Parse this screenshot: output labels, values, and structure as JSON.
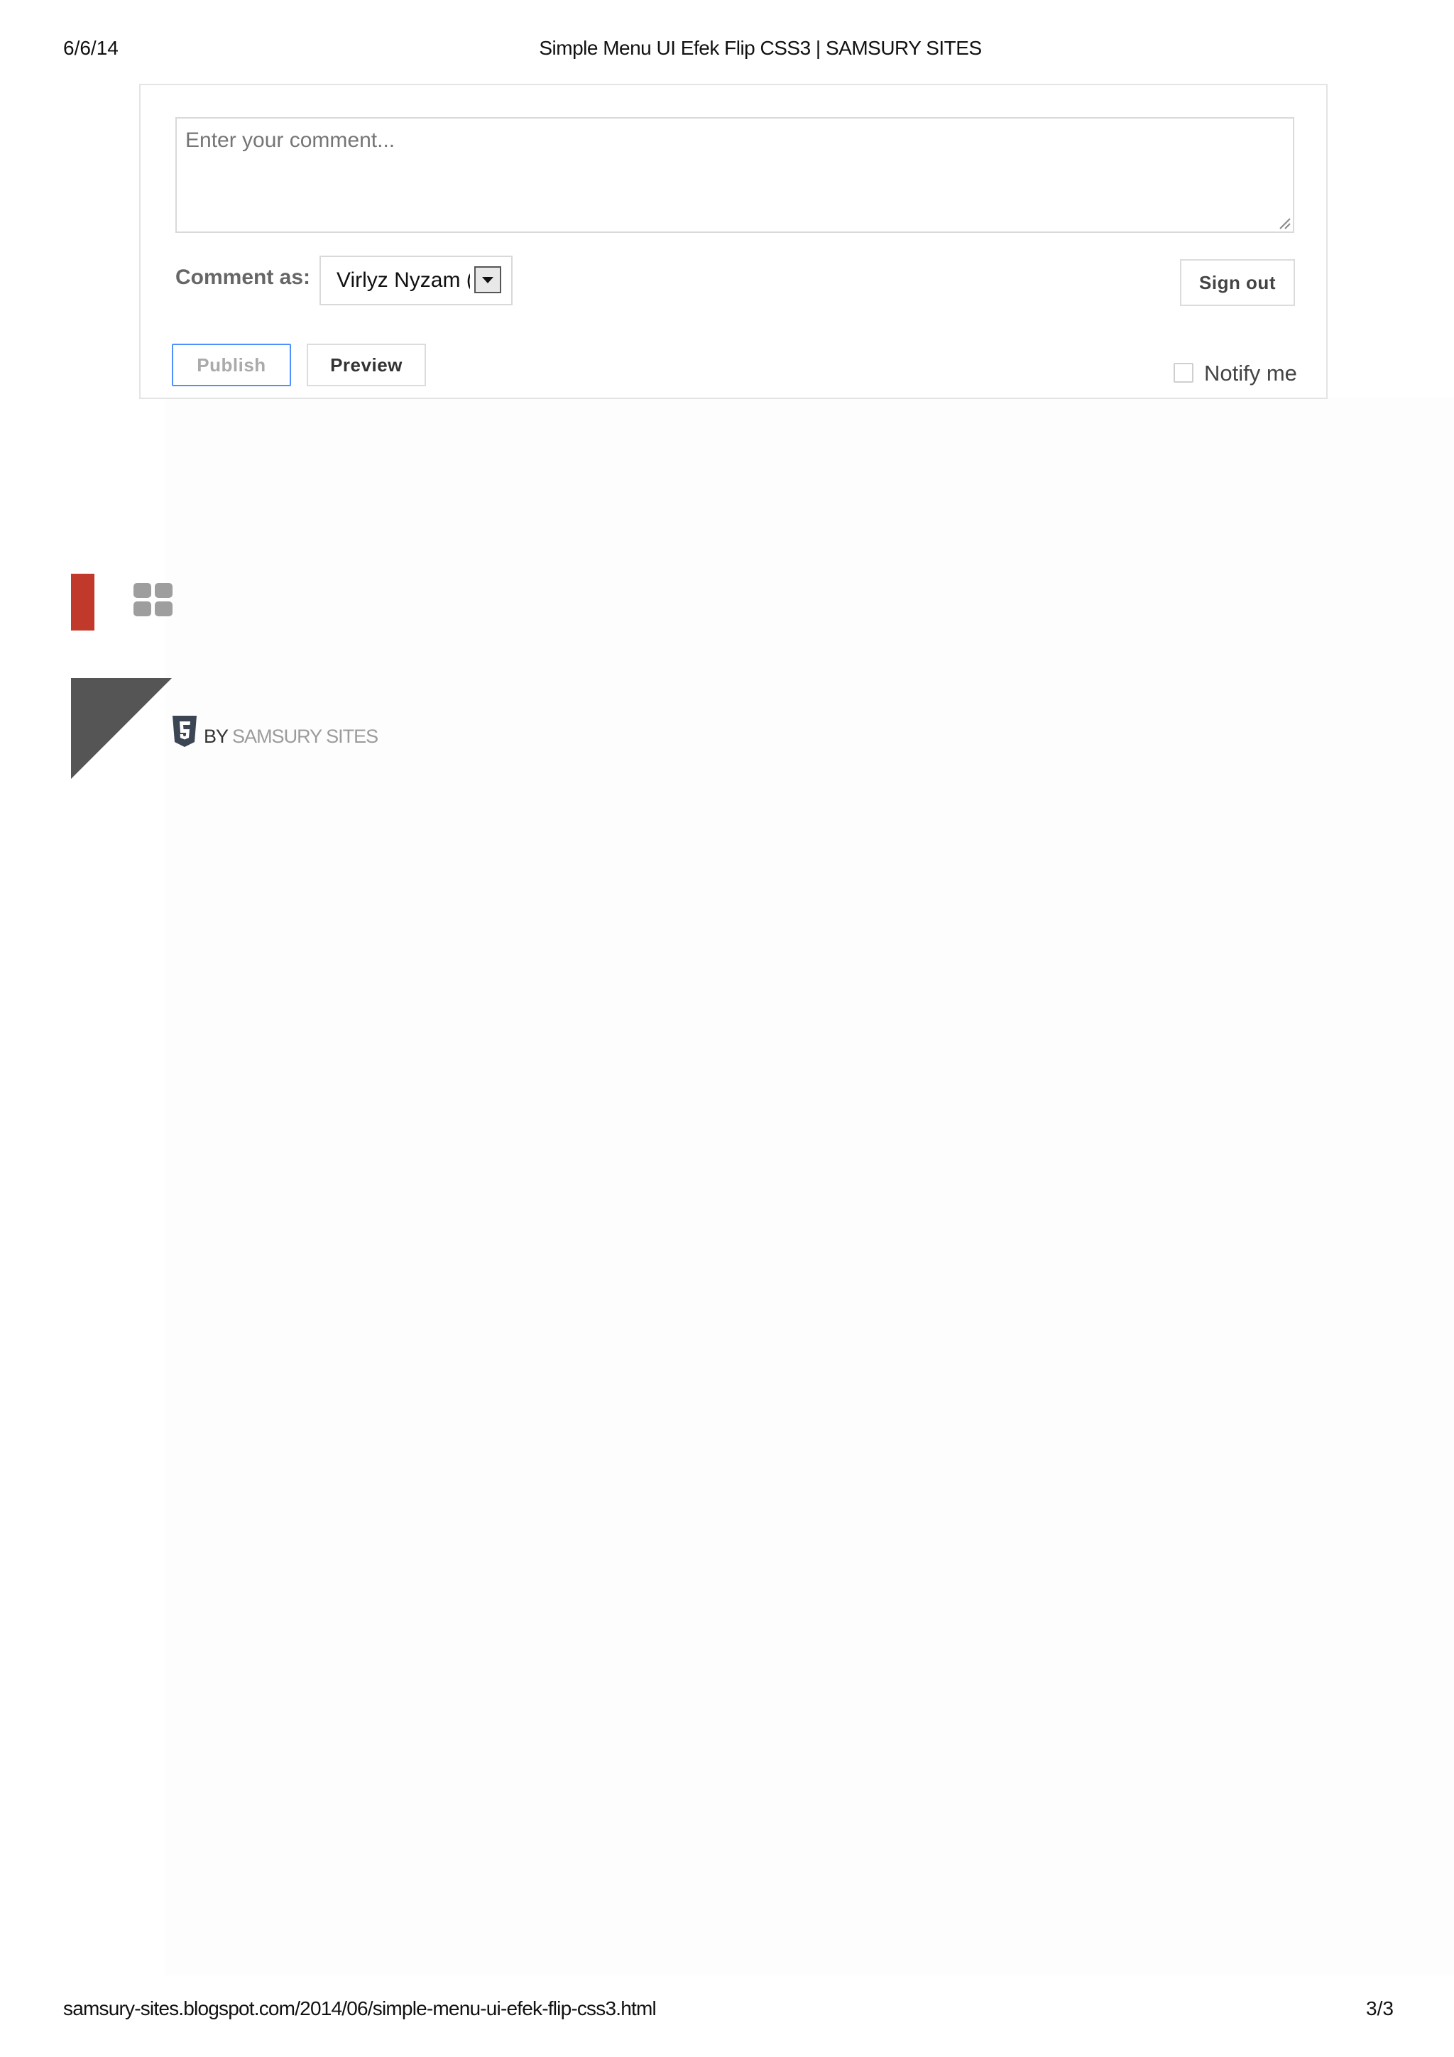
{
  "print_header": {
    "date": "6/6/14",
    "title": "Simple Menu UI Efek Flip CSS3 | SAMSURY SITES"
  },
  "comment_form": {
    "textarea_placeholder": "Enter your comment...",
    "comment_as_label": "Comment as:",
    "identity_value": "Virlyz Nyzam (Google)",
    "sign_out_label": "Sign out",
    "publish_label": "Publish",
    "preview_label": "Preview",
    "notify_label": "Notify me",
    "notify_checked": false
  },
  "widgets": {
    "accent_color": "#c0392b",
    "grid_icon": "grid-view-icon",
    "triangle_color": "#555555"
  },
  "credit": {
    "icon": "html5-shield-icon",
    "by_label": "BY",
    "site_name": "SAMSURY SITES"
  },
  "print_footer": {
    "url": "samsury-sites.blogspot.com/2014/06/simple-menu-ui-efek-flip-css3.html",
    "page": "3/3"
  }
}
